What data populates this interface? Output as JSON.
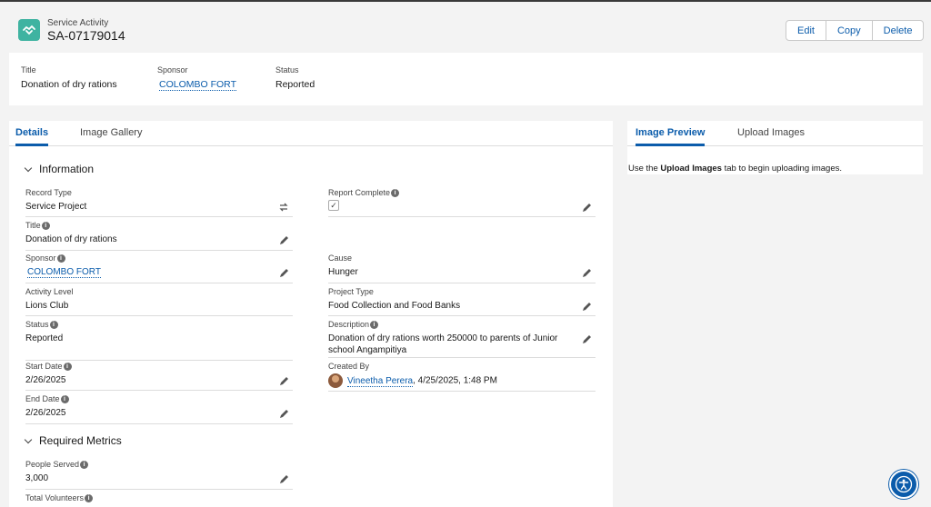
{
  "header": {
    "object_type": "Service Activity",
    "record_name": "SA-07179014",
    "actions": [
      "Edit",
      "Copy",
      "Delete"
    ]
  },
  "highlights": [
    {
      "label": "Title",
      "value": "Donation of dry rations",
      "link": false
    },
    {
      "label": "Sponsor",
      "value": "COLOMBO FORT",
      "link": true
    },
    {
      "label": "Status",
      "value": "Reported",
      "link": false
    }
  ],
  "main": {
    "tabs": [
      "Details",
      "Image Gallery"
    ],
    "active_tab": "Details",
    "sections": {
      "information": "Information",
      "required_metrics": "Required Metrics"
    },
    "fields": {
      "record_type": {
        "label": "Record Type",
        "value": "Service Project"
      },
      "report_complete": {
        "label": "Report Complete",
        "value": "✓"
      },
      "title": {
        "label": "Title",
        "value": "Donation of dry rations"
      },
      "sponsor": {
        "label": "Sponsor",
        "value": "COLOMBO FORT"
      },
      "cause": {
        "label": "Cause",
        "value": "Hunger"
      },
      "activity_level": {
        "label": "Activity Level",
        "value": "Lions Club"
      },
      "project_type": {
        "label": "Project Type",
        "value": "Food Collection and Food Banks"
      },
      "status": {
        "label": "Status",
        "value": "Reported"
      },
      "description": {
        "label": "Description",
        "value": "Donation of dry rations worth 250000 to parents of Junior school Angampitiya"
      },
      "start_date": {
        "label": "Start Date",
        "value": "2/26/2025"
      },
      "created_by": {
        "label": "Created By",
        "user": "Vineetha Perera",
        "date": ", 4/25/2025, 1:48 PM"
      },
      "end_date": {
        "label": "End Date",
        "value": "2/26/2025"
      },
      "people_served": {
        "label": "People Served",
        "value": "3,000"
      },
      "total_volunteers": {
        "label": "Total Volunteers",
        "value": ""
      }
    }
  },
  "side": {
    "tabs": [
      "Image Preview",
      "Upload Images"
    ],
    "active_tab": "Image Preview",
    "hint_pre": "Use the ",
    "hint_bold": "Upload Images",
    "hint_post": " tab to begin uploading images."
  },
  "colors": {
    "brand": "#0b5cab",
    "object_icon": "#3fb3a1"
  },
  "icons": {
    "object": "handshake-icon",
    "edit": "pencil-icon",
    "record_type": "swap-icon",
    "accessibility": "accessibility-icon",
    "info": "info-icon"
  }
}
